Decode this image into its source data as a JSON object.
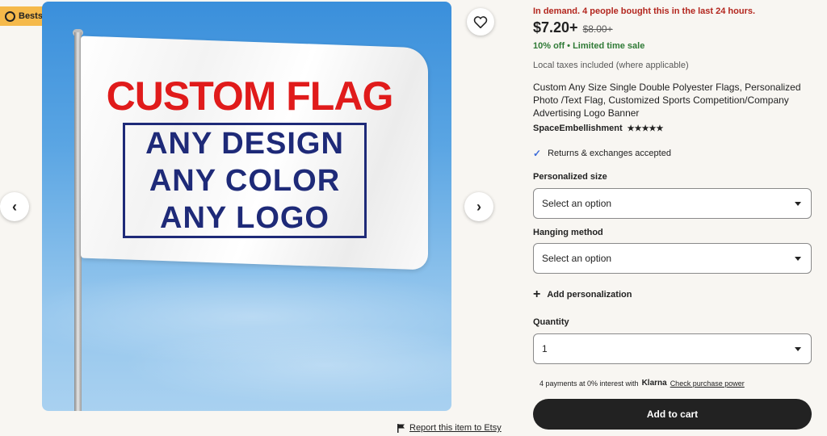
{
  "badge": {
    "label": "Bestseller"
  },
  "gallery": {
    "flag_title": "CUSTOM FLAG",
    "flag_lines": [
      "ANY DESIGN",
      "ANY COLOR",
      "ANY LOGO"
    ]
  },
  "nav": {
    "prev_icon": "chevron-left-icon",
    "next_icon": "chevron-right-icon",
    "prev": "‹",
    "next": "›"
  },
  "report": {
    "label": "Report this item to Etsy"
  },
  "listing": {
    "demand": "In demand. 4 people bought this in the last 24 hours.",
    "price": "$7.20+",
    "old_price": "$8.00+",
    "sale": "10% off  •  Limited time sale",
    "taxes": "Local taxes included (where applicable)",
    "title": "Custom Any Size Single Double Polyester Flags, Personalized Photo /Text Flag, Customized Sports Competition/Company Advertising Logo Banner",
    "shop": "SpaceEmbellishment",
    "stars": "★★★★★",
    "rating": 4.5,
    "returns": "Returns & exchanges accepted"
  },
  "options": {
    "size_label": "Personalized size",
    "size_value": "Select an option",
    "hanging_label": "Hanging method",
    "hanging_value": "Select an option",
    "add_personalization": "Add personalization",
    "quantity_label": "Quantity",
    "quantity_value": "1"
  },
  "klarna": {
    "text": "4 payments at 0% interest with",
    "brand": "Klarna",
    "link": "Check purchase power"
  },
  "cart": {
    "label": "Add to cart"
  },
  "colors": {
    "accent_red": "#b3261e",
    "sale_green": "#2f7a36",
    "badge_yellow": "#f5b94a",
    "cart_bg": "#222222"
  }
}
